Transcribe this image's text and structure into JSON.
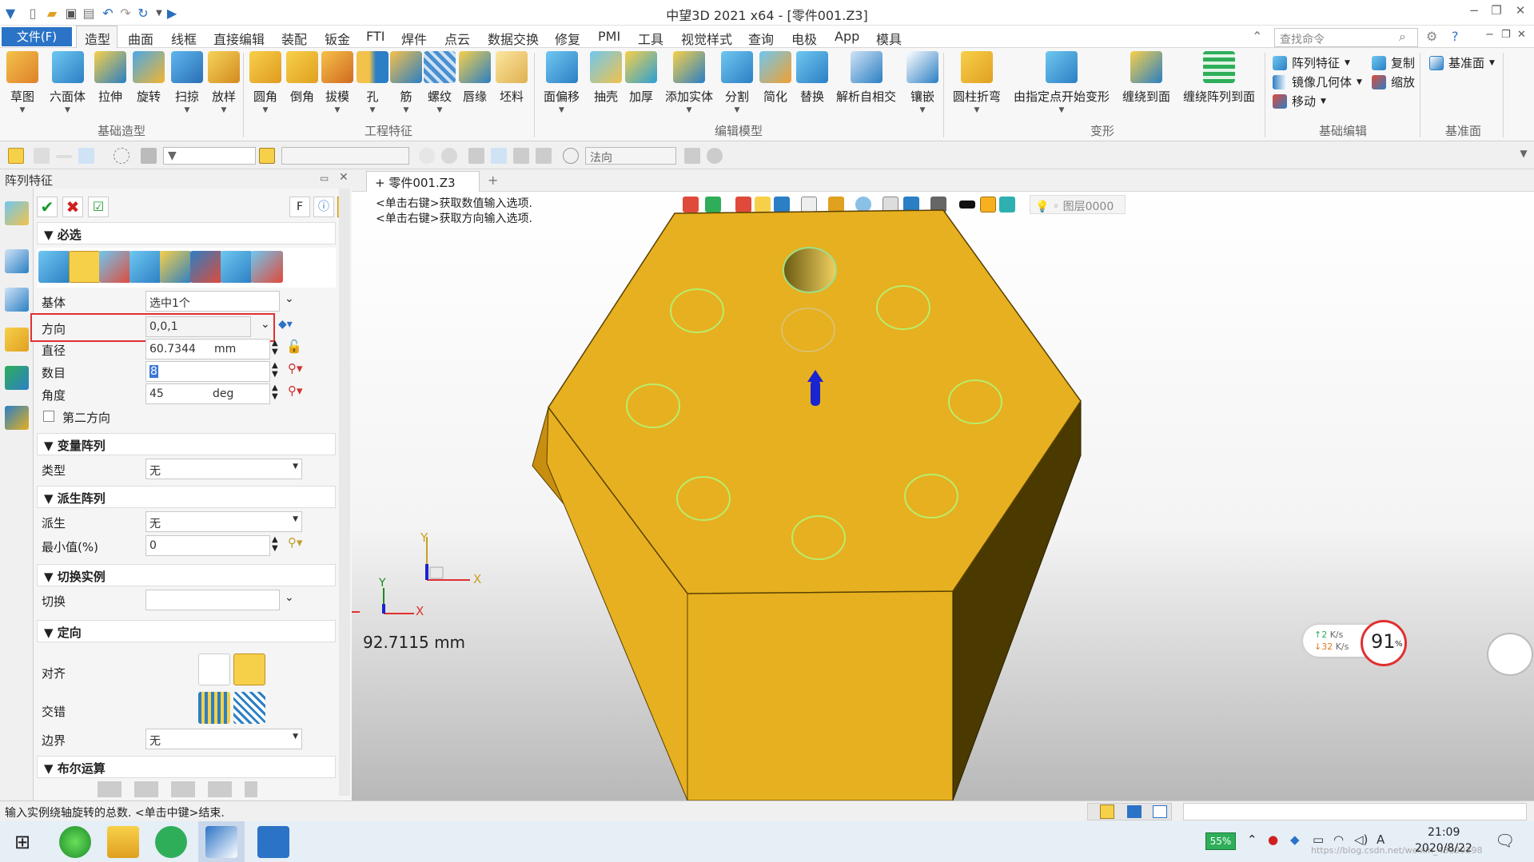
{
  "window": {
    "title": "中望3D 2021 x64 - [零件001.Z3]"
  },
  "menu": {
    "file": "文件(F)",
    "tabs": [
      "造型",
      "曲面",
      "线框",
      "直接编辑",
      "装配",
      "钣金",
      "FTI",
      "焊件",
      "点云",
      "数据交换",
      "修复",
      "PMI",
      "工具",
      "视觉样式",
      "查询",
      "电极",
      "App",
      "模具"
    ],
    "search_placeholder": "查找命令"
  },
  "ribbon": {
    "basic_shapes": [
      "草图",
      "六面体",
      "拉伸",
      "旋转",
      "扫掠",
      "放样"
    ],
    "engineering": [
      "圆角",
      "倒角",
      "拔模",
      "孔",
      "筋",
      "螺纹",
      "唇缘",
      "坯料"
    ],
    "edit_model": [
      "面偏移",
      "抽壳",
      "加厚",
      "添加实体",
      "分割",
      "简化",
      "替换",
      "解析自相交",
      "镶嵌"
    ],
    "deform": [
      "圆柱折弯",
      "由指定点开始变形",
      "缠绕到面",
      "缠绕阵列到面"
    ],
    "basic_edit": {
      "items": [
        "阵列特征",
        "镜像几何体",
        "移动",
        "复制",
        "缩放"
      ]
    },
    "datum": {
      "label": "基准面"
    },
    "groups": [
      "基础造型",
      "工程特征",
      "编辑模型",
      "变形",
      "基础编辑",
      "基准面"
    ]
  },
  "toolbar2": {
    "filter_value": "法向"
  },
  "panel": {
    "title": "阵列特征",
    "f_button": "F",
    "sections": {
      "required": "必选",
      "variable": "变量阵列",
      "derived": "派生阵列",
      "toggle": "切换实例",
      "orient": "定向",
      "boolean": "布尔运算"
    },
    "fields": {
      "base_label": "基体",
      "base_value": "选中1个",
      "dir_label": "方向",
      "dir_value": "0,0,1",
      "diam_label": "直径",
      "diam_value": "60.7344",
      "diam_unit": "mm",
      "count_label": "数目",
      "count_value": "8",
      "angle_label": "角度",
      "angle_value": "45",
      "angle_unit": "deg",
      "second_dir": "第二方向",
      "type_label": "类型",
      "type_value": "无",
      "derive_label": "派生",
      "derive_value": "无",
      "min_label": "最小值(%)",
      "min_value": "0",
      "toggle_label": "切换",
      "align_label": "对齐",
      "stagger_label": "交错",
      "boundary_label": "边界",
      "boundary_value": "无"
    }
  },
  "doc": {
    "tab": "零件001.Z3"
  },
  "viewport": {
    "hint1": "<单击右键>获取数值输入选项.",
    "hint2": "<单击右键>获取方向输入选项.",
    "layer": "图层0000",
    "measure": "92.7115 mm",
    "axis_x": "X",
    "axis_y": "Y"
  },
  "status": {
    "message": "输入实例绕轴旋转的总数. <单击中键>结束."
  },
  "net": {
    "up": "2",
    "down": "32",
    "unit": "K/s",
    "cpu": "91",
    "pct": "%"
  },
  "taskbar": {
    "battery": "55%",
    "time": "21:09",
    "date": "2020/8/22",
    "url": "https://blog.csdn.net/weixin_43999298"
  },
  "colors": {
    "accent": "#2b73c6",
    "part": "#e6b020",
    "highlight": "#e03030"
  }
}
